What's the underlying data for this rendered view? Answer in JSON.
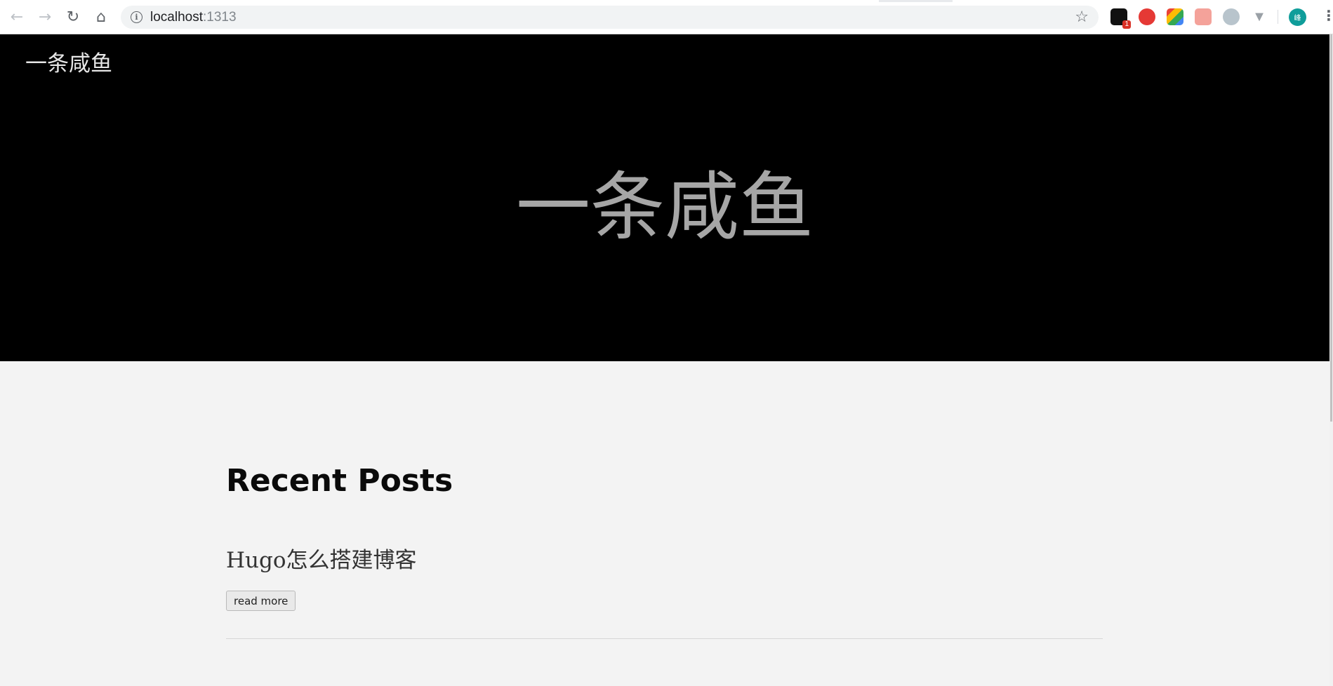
{
  "browser": {
    "url_host": "localhost",
    "url_port": ":1313",
    "extension_badge": "1",
    "avatar_label": "峰",
    "icons": [
      "back-icon",
      "forward-icon",
      "reload-icon",
      "home-icon",
      "info-icon",
      "star-icon",
      "menu-icon"
    ]
  },
  "site": {
    "brand": "一条咸鱼",
    "hero_title": "一条咸鱼"
  },
  "main": {
    "section_title": "Recent Posts",
    "posts": [
      {
        "title": "Hugo怎么搭建博客",
        "read_more": "read more"
      }
    ]
  },
  "colors": {
    "hero_bg": "#000000",
    "page_bg": "#f3f3f3",
    "hero_title": "#a6a6a6"
  }
}
